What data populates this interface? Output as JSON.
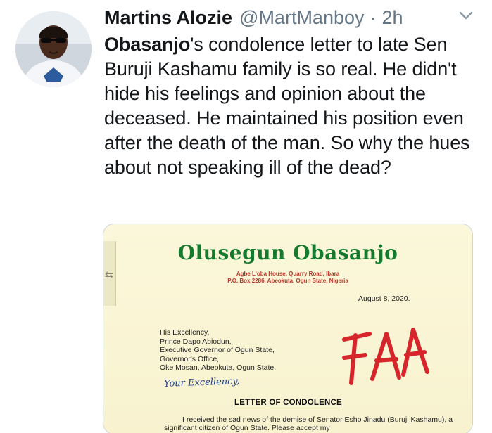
{
  "tweet": {
    "author_name": "Martins Alozie",
    "handle": "@MartManboy",
    "separator": "·",
    "time": "2h",
    "text_mention": "Obasanjo",
    "text_rest": "'s condolence letter to late Sen Buruji Kashamu family is so real. He didn't hide his feelings and opinion about the deceased. He maintained his position even after the death of the man. So why the hues about not speaking ill of the dead?"
  },
  "letter": {
    "letterhead_name": "Olusegun Obasanjo",
    "address_line1": "Agbe L'oba House, Quarry Road, Ibara",
    "address_line2": "P.O. Box 2286, Abeokuta, Ogun State, Nigeria",
    "date": "August 8, 2020.",
    "recipient": [
      "His Excellency,",
      "Prince Dapo Abiodun,",
      "Executive Governor of Ogun State,",
      "Governor's Office,",
      "Oke Mosan, Abeokuta, Ogun State."
    ],
    "salutation": "Your Excellency,",
    "stamp_text": "FAA",
    "heading": "LETTER OF CONDOLENCE",
    "body": "I received the sad news of the demise of Senator Esho Jinadu (Buruji Kashamu), a significant citizen of Ogun State. Please accept my"
  },
  "colors": {
    "text": "#14171a",
    "muted": "#657786",
    "letterhead_green": "#157a2e",
    "letterhead_red": "#b5392b",
    "stamp_red": "#d7262b",
    "paper": "#fbf6d8"
  },
  "icons": {
    "chevron": "chevron-down-icon",
    "handle": "double-arrow-icon"
  }
}
